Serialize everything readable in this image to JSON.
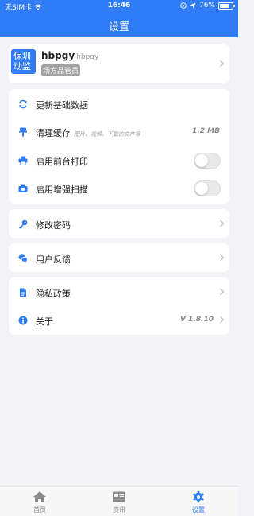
{
  "status_bar": {
    "carrier": "无SIM卡",
    "time": "16:46",
    "battery": "76%",
    "battery_level": 0.76
  },
  "header": {
    "title": "设置"
  },
  "profile": {
    "logo_text_line1": "保圳",
    "logo_text_line2": "动监",
    "name": "hbpgy",
    "id": "hbpgy",
    "role": "场方品管员"
  },
  "settings": {
    "update_data": {
      "label": "更新基础数据",
      "icon": "refresh-icon"
    },
    "clear_cache": {
      "label": "清理缓存",
      "hint": "图片、视频、下载的文件等",
      "value": "1.2 MB",
      "icon": "broom-icon"
    },
    "front_print": {
      "label": "启用前台打印",
      "enabled": false,
      "icon": "printer-icon"
    },
    "enhanced_scan": {
      "label": "启用增强扫描",
      "enabled": false,
      "icon": "camera-icon"
    },
    "change_password": {
      "label": "修改密码",
      "icon": "key-icon"
    },
    "feedback": {
      "label": "用户反馈",
      "icon": "chat-icon"
    },
    "privacy": {
      "label": "隐私政策",
      "icon": "document-icon"
    },
    "about": {
      "label": "关于",
      "version": "V 1.8.10",
      "icon": "info-icon"
    }
  },
  "tabbar": [
    {
      "label": "首页",
      "icon": "home-icon",
      "active": false
    },
    {
      "label": "资讯",
      "icon": "news-icon",
      "active": false
    },
    {
      "label": "设置",
      "icon": "gear-icon",
      "active": true
    }
  ],
  "colors": {
    "accent": "#2f7cf6",
    "background": "#f2f2f7"
  }
}
